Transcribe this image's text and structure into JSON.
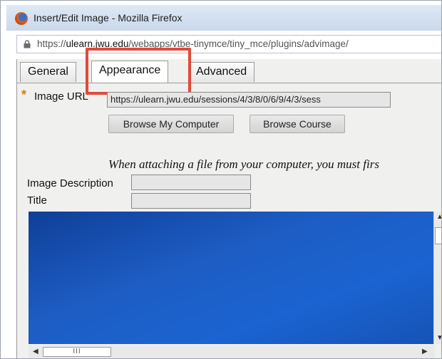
{
  "window": {
    "title": "Insert/Edit Image - Mozilla Firefox"
  },
  "urlbar": {
    "prefix": "https://",
    "host": "ulearn.jwu.edu",
    "path": "/webapps/vtbe-tinymce/tiny_mce/plugins/advimage/"
  },
  "tabs": [
    {
      "label": "General"
    },
    {
      "label": "Appearance"
    },
    {
      "label": "Advanced"
    }
  ],
  "form": {
    "image_url_label": "Image URL",
    "required_mark": "*",
    "image_url_value": "https://ulearn.jwu.edu/sessions/4/3/8/0/6/9/4/3/sess",
    "browse_computer_label": "Browse My Computer",
    "browse_course_label": "Browse Course",
    "note": "When attaching a file from your computer, you must firs",
    "image_description_label": "Image Description",
    "title_label": "Title",
    "image_description_value": "",
    "title_value": ""
  },
  "scrollbar": {
    "h_thumb_grip": "III"
  },
  "colors": {
    "highlight": "#e04a3a",
    "preview_blue": "#1b63d0",
    "required": "#e07a00"
  }
}
